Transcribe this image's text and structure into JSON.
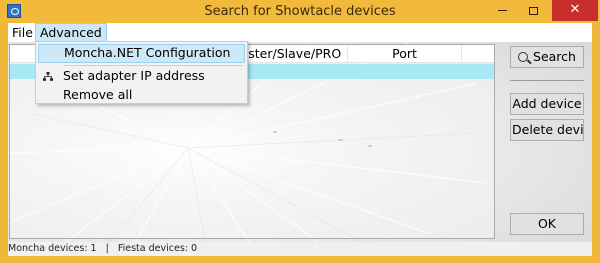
{
  "window": {
    "title": "Search for Showtacle devices",
    "close_glyph": "✕"
  },
  "menubar": {
    "file_label": "File",
    "advanced_label": "Advanced"
  },
  "advanced_menu": {
    "items": [
      {
        "label": "Moncha.NET Configuration",
        "icon": null
      },
      {
        "label": "Set adapter IP address",
        "icon": "network-icon"
      },
      {
        "label": "Remove all",
        "icon": null
      }
    ]
  },
  "device_list": {
    "columns": [
      "",
      "Master/Slave/PRO",
      "Port",
      ""
    ],
    "rows": [
      {
        "cells": [
          "",
          "",
          "",
          ""
        ],
        "selected": true
      }
    ]
  },
  "buttons": {
    "search": "Search",
    "add_device": "Add device",
    "delete_device": "Delete device",
    "ok": "OK"
  },
  "status": {
    "text": "Moncha devices: 1   |   Fiesta devices: 0"
  },
  "colors": {
    "frame": "#f0b73a",
    "close_button": "#c7302a",
    "selection": "#cce8f8",
    "list_row_highlight": "#a7e8f4"
  }
}
